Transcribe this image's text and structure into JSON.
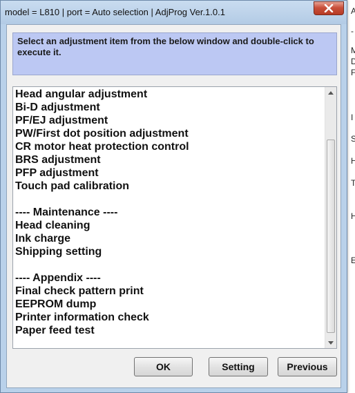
{
  "window": {
    "title": "model = L810 | port = Auto selection | AdjProg Ver.1.0.1",
    "close_icon": "close-icon"
  },
  "instruction": "Select an adjustment item from the below window and double-click to execute it.",
  "list_items": [
    "Head angular adjustment",
    "Bi-D adjustment",
    "PF/EJ adjustment",
    "PW/First dot position adjustment",
    "CR motor heat protection control",
    "BRS adjustment",
    "PFP adjustment",
    "Touch pad calibration",
    "",
    "---- Maintenance ----",
    "Head cleaning",
    "Ink charge",
    "Shipping setting",
    "",
    "---- Appendix ----",
    "Final check pattern print",
    "EEPROM dump",
    "Printer information check",
    "Paper feed test"
  ],
  "buttons": {
    "ok": "OK",
    "setting": "Setting",
    "previous": "Previous"
  },
  "background_window": {
    "letters": [
      "A",
      "-",
      "M",
      "D",
      "F",
      "I",
      "S",
      "H",
      "T",
      "H",
      "E"
    ]
  },
  "colors": {
    "instruction_bg": "#bcc8f3",
    "frame": "#b9d1ea",
    "close_button": "#c9503b"
  }
}
